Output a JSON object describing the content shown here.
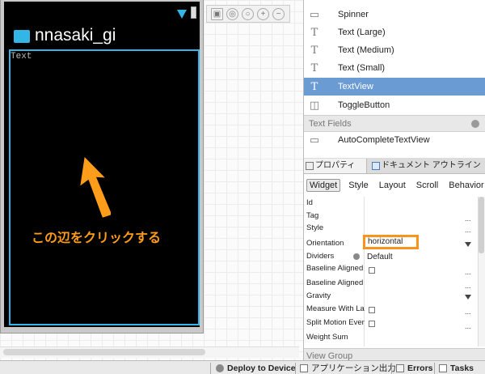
{
  "device": {
    "app_title": "nnasaki_gi",
    "text_label": "Text",
    "caption": "この辺をクリックする"
  },
  "palette": {
    "items": [
      {
        "icon": "spinner-icon",
        "label": "Spinner"
      },
      {
        "icon": "text-icon",
        "label": "Text (Large)"
      },
      {
        "icon": "text-icon",
        "label": "Text (Medium)"
      },
      {
        "icon": "text-icon",
        "label": "Text (Small)"
      },
      {
        "icon": "text-icon",
        "label": "TextView",
        "selected": true
      },
      {
        "icon": "toggle-icon",
        "label": "ToggleButton"
      }
    ],
    "category": "Text Fields",
    "field_items": [
      {
        "icon": "autocomplete-icon",
        "label": "AutoCompleteTextView"
      }
    ]
  },
  "properties": {
    "tab_properties": "プロパティ",
    "tab_outline": "ドキュメント アウトライン",
    "subtabs": [
      "Widget",
      "Style",
      "Layout",
      "Scroll",
      "Behavior"
    ],
    "rows": {
      "id": "Id",
      "tag": "Tag",
      "style": "Style",
      "orientation": "Orientation",
      "dividers": "Dividers",
      "baseline_aligned": "Baseline Aligned",
      "baseline_aligned_c": "Baseline Aligned C",
      "gravity": "Gravity",
      "measure": "Measure With Larg",
      "split_motion": "Split Motion Event",
      "weight_sum": "Weight Sum"
    },
    "orientation_value": "horizontal",
    "dividers_value": "Default",
    "dots": "...",
    "view_group": "View Group"
  },
  "statusbar": {
    "deploy": "Deploy to Device",
    "app_output": "アプリケーション出力",
    "errors": "Errors",
    "tasks": "Tasks"
  },
  "colors": {
    "accent_blue": "#33b5e5",
    "highlight_orange": "#f7941d",
    "caption_orange": "#ff9c1a",
    "selection_blue": "#6b9bd3"
  }
}
